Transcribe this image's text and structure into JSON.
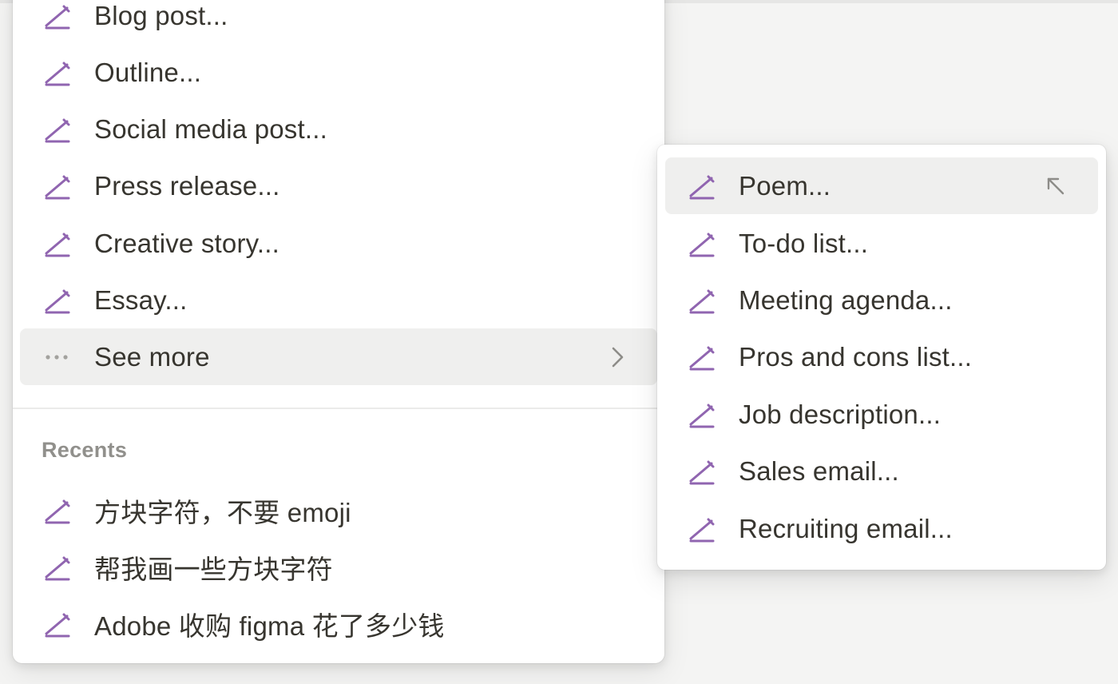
{
  "main_menu": {
    "items": [
      {
        "label": "Blog post...",
        "icon": "pencil-icon"
      },
      {
        "label": "Outline...",
        "icon": "pencil-icon"
      },
      {
        "label": "Social media post...",
        "icon": "pencil-icon"
      },
      {
        "label": "Press release...",
        "icon": "pencil-icon"
      },
      {
        "label": "Creative story...",
        "icon": "pencil-icon"
      },
      {
        "label": "Essay...",
        "icon": "pencil-icon"
      }
    ],
    "see_more": {
      "label": "See more",
      "icon": "more-dots-icon",
      "chevron": "chevron-right-icon"
    },
    "recents": {
      "heading": "Recents",
      "items": [
        {
          "label": "方块字符，不要 emoji",
          "icon": "pencil-icon"
        },
        {
          "label": "帮我画一些方块字符",
          "icon": "pencil-icon"
        },
        {
          "label": "Adobe 收购 figma 花了多少钱",
          "icon": "pencil-icon"
        }
      ]
    }
  },
  "sub_menu": {
    "items": [
      {
        "label": "Poem...",
        "icon": "pencil-icon",
        "selected": true,
        "hint_icon": "return-arrow-icon"
      },
      {
        "label": "To-do list...",
        "icon": "pencil-icon"
      },
      {
        "label": "Meeting agenda...",
        "icon": "pencil-icon"
      },
      {
        "label": "Pros and cons list...",
        "icon": "pencil-icon"
      },
      {
        "label": "Job description...",
        "icon": "pencil-icon"
      },
      {
        "label": "Sales email...",
        "icon": "pencil-icon"
      },
      {
        "label": "Recruiting email...",
        "icon": "pencil-icon"
      }
    ]
  },
  "colors": {
    "accent_icon": "#9065b0",
    "text": "#37352f",
    "muted": "#91908c",
    "highlight": "#efefee"
  }
}
